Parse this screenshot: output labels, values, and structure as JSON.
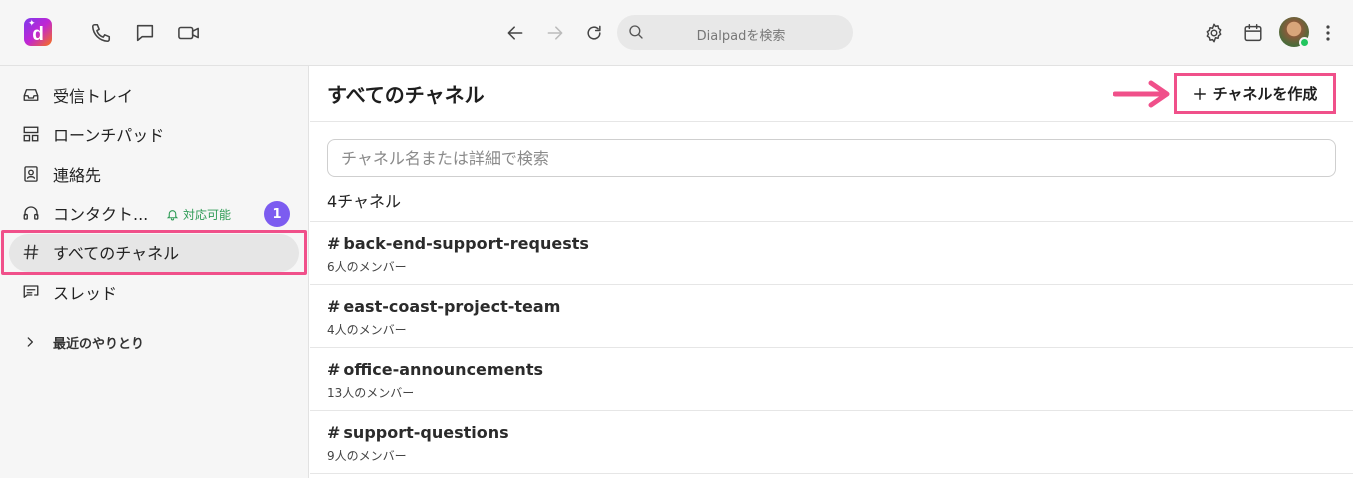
{
  "app": {
    "search_placeholder": "Dialpadを検索"
  },
  "sidebar": {
    "items": [
      {
        "label": "受信トレイ",
        "icon": "inbox-icon"
      },
      {
        "label": "ローンチパッド",
        "icon": "launchpad-icon"
      },
      {
        "label": "連絡先",
        "icon": "contacts-icon"
      },
      {
        "label": "コンタクト...",
        "icon": "headset-icon",
        "status": "対応可能",
        "badge": "1"
      },
      {
        "label": "すべてのチャネル",
        "icon": "hash-icon",
        "active": true
      },
      {
        "label": "スレッド",
        "icon": "threads-icon"
      }
    ],
    "recent_label": "最近のやりとり"
  },
  "main": {
    "title": "すべてのチャネル",
    "create_button_label": "チャネルを作成",
    "filter_placeholder": "チャネル名または詳細で検索",
    "channel_count": "4チャネル",
    "channels": [
      {
        "name": "back-end-support-requests",
        "members": "6人のメンバー"
      },
      {
        "name": "east-coast-project-team",
        "members": "4人のメンバー"
      },
      {
        "name": "office-announcements",
        "members": "13人のメンバー"
      },
      {
        "name": "support-questions",
        "members": "9人のメンバー"
      }
    ]
  },
  "colors": {
    "highlight": "#f0508a",
    "badge": "#7c5cf0",
    "status_available": "#2e9b55"
  }
}
